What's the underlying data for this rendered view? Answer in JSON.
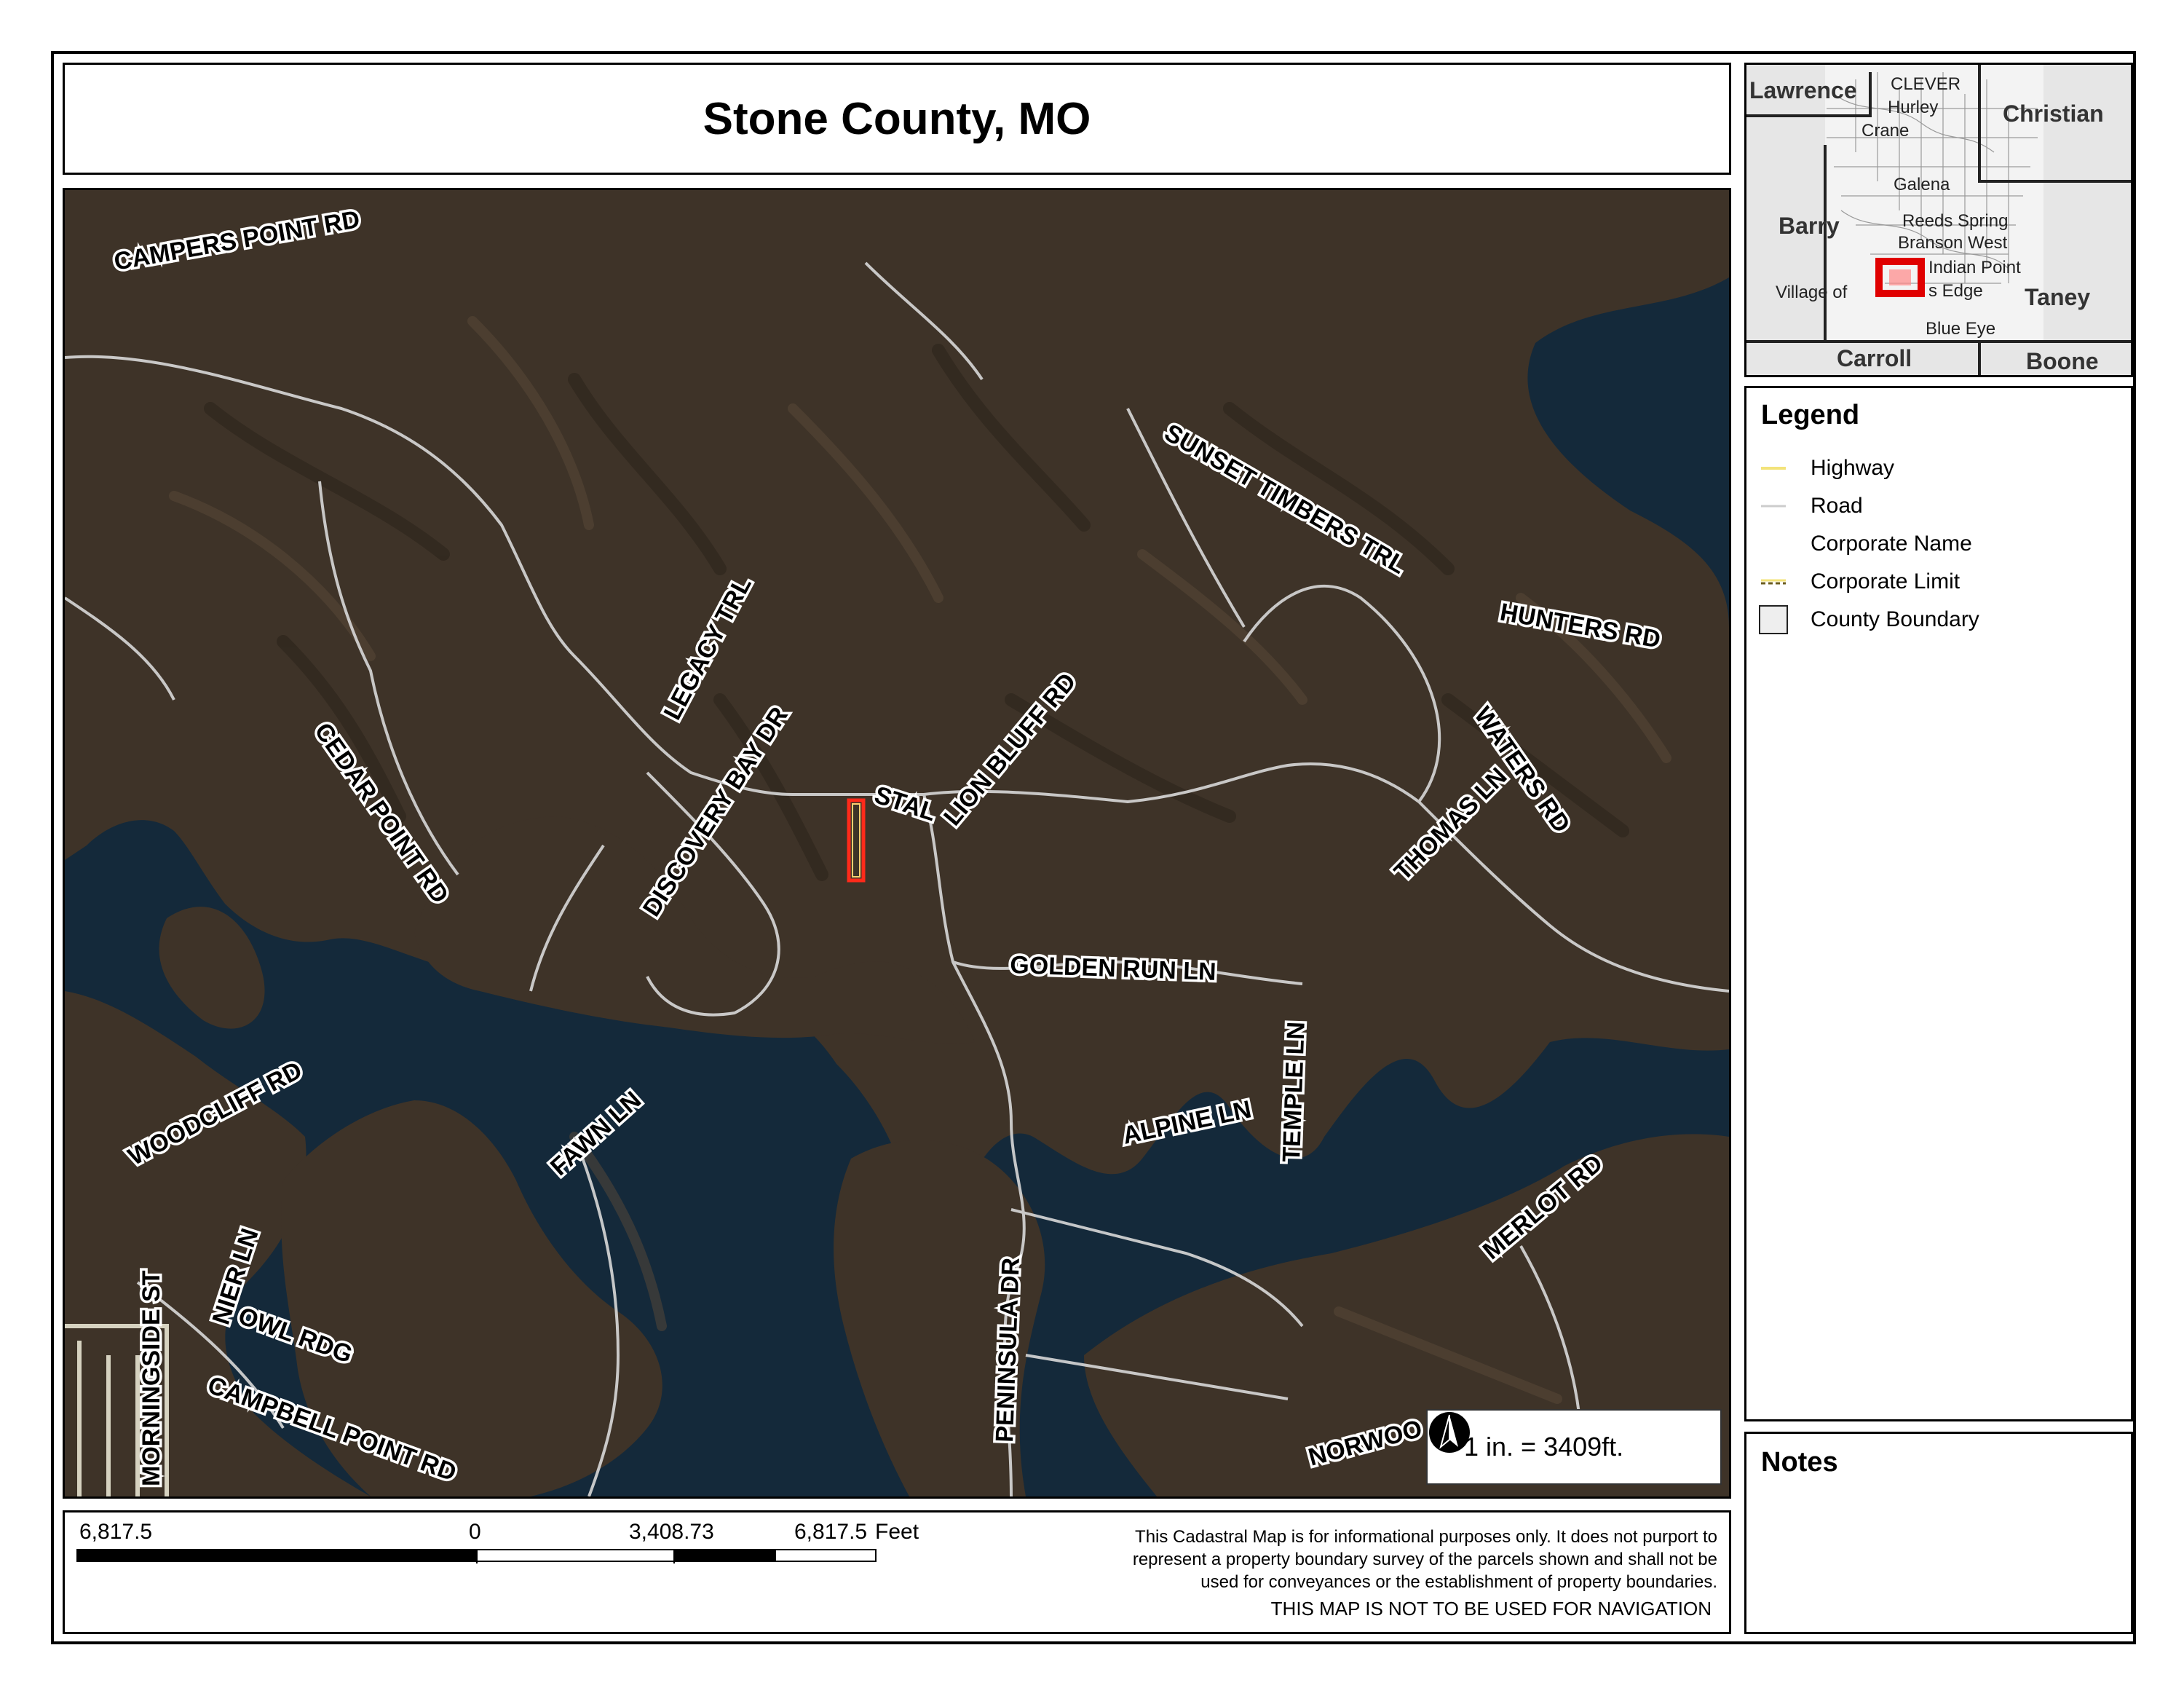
{
  "title": "Stone County, MO",
  "map": {
    "road_labels": [
      "CAMPERS POINT RD",
      "SUNSET TIMBERS TRL",
      "HUNTERS RD",
      "LEGACY TRL",
      "CEDAR POINT RD",
      "DISCOVERY BAY DR",
      "STAL",
      "LION BLUFF RD",
      "WATERS RD",
      "THOMAS LN",
      "GOLDEN RUN LN",
      "TEMPLE LN",
      "ALPINE LN",
      "WOODCLIFF RD",
      "FAWN LN",
      "MERLOT RD",
      "NIER LN",
      "OWL RDG",
      "MORNINGSIDE ST",
      "CAMPBELL POINT RD",
      "PENINSULA DR",
      "NORWOO"
    ],
    "scale_text": "1 in. = 3409ft.",
    "parcel_color": "#ff2a1a",
    "water_color": "#14293a",
    "land_color": "#3e3328"
  },
  "scale_bar": {
    "labels": [
      "6,817.5",
      "0",
      "3,408.73",
      "6,817.5"
    ],
    "unit": "Feet"
  },
  "disclaimer": {
    "lines": [
      "This Cadastral Map is for informational purposes only.  It does not purport to",
      "represent a property boundary survey of the parcels shown and shall not be",
      "used for conveyances or the establishment of property boundaries."
    ],
    "navigation_note": "THIS MAP IS NOT TO BE USED FOR NAVIGATION"
  },
  "inset": {
    "counties": [
      "Lawrence",
      "Christian",
      "Barry",
      "Taney",
      "Carroll",
      "Boone"
    ],
    "towns": [
      "CLEVER",
      "Hurley",
      "Crane",
      "Galena",
      "Reeds Spring",
      "Branson West",
      "Indian Point",
      "Village of",
      "s Edge",
      "Blue Eye"
    ],
    "highlight_color": "#e00000"
  },
  "legend": {
    "title": "Legend",
    "items": [
      {
        "label": "Highway",
        "swatch": "highway",
        "color": "#f3e37a"
      },
      {
        "label": "Road",
        "swatch": "road",
        "color": "#cccccc"
      },
      {
        "label": "Corporate Name",
        "swatch": "none",
        "color": ""
      },
      {
        "label": "Corporate Limit",
        "swatch": "corporate-limit",
        "color": "#8a7a2a"
      },
      {
        "label": "County Boundary",
        "swatch": "county-boundary",
        "color": "#eeeeee"
      }
    ]
  },
  "notes": {
    "title": "Notes"
  }
}
